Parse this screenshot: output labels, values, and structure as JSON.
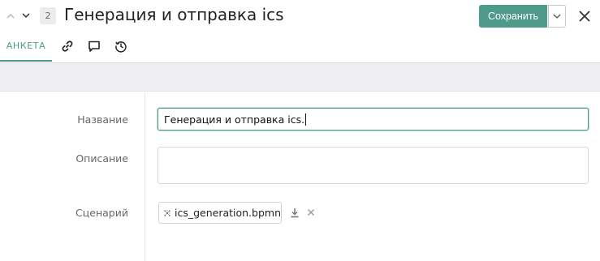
{
  "header": {
    "nav_up_icon": "chevron-up-icon",
    "nav_down_icon": "chevron-down-icon",
    "id_badge": "2",
    "title": "Генерация и отправка ics",
    "save_label": "Сохранить",
    "save_menu_icon": "chevron-down-icon",
    "close_icon": "close-icon",
    "accent_color": "#4f9a8a"
  },
  "tabs": {
    "anketa_label": "АНКЕТА",
    "icons": [
      "link-icon",
      "comment-icon",
      "history-icon"
    ]
  },
  "form": {
    "name_label": "Название",
    "name_value": "Генерация и отправка ics.",
    "description_label": "Описание",
    "description_value": "",
    "scenario_label": "Сценарий",
    "scenario_file": "ics_generation.bpmn",
    "scenario_file_icon": "bpmn-diagram-icon",
    "download_icon": "download-icon",
    "remove_icon": "close-icon"
  }
}
